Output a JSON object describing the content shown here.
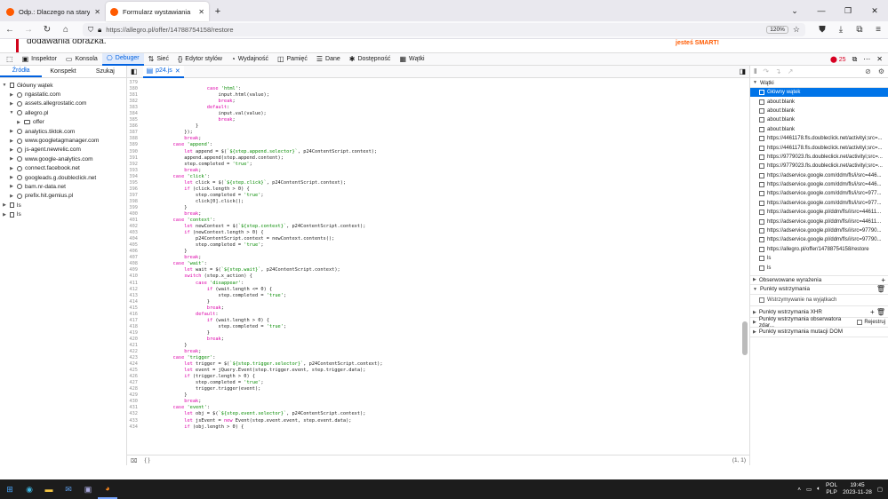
{
  "browser": {
    "tabs": [
      {
        "title": "Odp.: Dlaczego na starym form",
        "active": false
      },
      {
        "title": "Formularz wystawiania",
        "active": true
      }
    ],
    "new_tab_symbol": "+",
    "url": "https://allegro.pl/offer/14788754158/restore",
    "zoom": "120%"
  },
  "page_strip": {
    "text": "dodawania obrazka.",
    "brand_partial": "jesteś SMART!"
  },
  "devtools": {
    "tools": [
      {
        "label": "Inspektor",
        "icon": "inspector-icon"
      },
      {
        "label": "Konsola",
        "icon": "console-icon"
      },
      {
        "label": "Debuger",
        "icon": "debugger-icon",
        "selected": true
      },
      {
        "label": "Sieć",
        "icon": "network-icon"
      },
      {
        "label": "Edytor stylów",
        "icon": "style-editor-icon"
      },
      {
        "label": "Wydajność",
        "icon": "performance-icon"
      },
      {
        "label": "Pamięć",
        "icon": "memory-icon"
      },
      {
        "label": "Dane",
        "icon": "storage-icon"
      },
      {
        "label": "Dostępność",
        "icon": "accessibility-icon"
      },
      {
        "label": "Wątki",
        "icon": "application-icon"
      }
    ],
    "error_count": "25"
  },
  "sources": {
    "tabs": [
      "Źródła",
      "Konspekt",
      "Szukaj"
    ],
    "tree": [
      {
        "label": "Główny wątek",
        "level": 0,
        "type": "file",
        "open": true
      },
      {
        "label": "ngastatic.com",
        "level": 1,
        "type": "globe"
      },
      {
        "label": "assets.allegrostatic.com",
        "level": 1,
        "type": "globe"
      },
      {
        "label": "allegro.pl",
        "level": 1,
        "type": "globe",
        "open": true
      },
      {
        "label": "offer",
        "level": 2,
        "type": "folder"
      },
      {
        "label": "analytics.tiktok.com",
        "level": 1,
        "type": "globe"
      },
      {
        "label": "www.googletagmanager.com",
        "level": 1,
        "type": "globe"
      },
      {
        "label": "js-agent.newrelic.com",
        "level": 1,
        "type": "globe"
      },
      {
        "label": "www.google-analytics.com",
        "level": 1,
        "type": "globe"
      },
      {
        "label": "connect.facebook.net",
        "level": 1,
        "type": "globe"
      },
      {
        "label": "googleads.g.doubleclick.net",
        "level": 1,
        "type": "globe"
      },
      {
        "label": "bam.nr-data.net",
        "level": 1,
        "type": "globe"
      },
      {
        "label": "prefix.hit.gemius.pl",
        "level": 1,
        "type": "globe"
      },
      {
        "label": "ls",
        "level": 0,
        "type": "file"
      },
      {
        "label": "ls",
        "level": 0,
        "type": "file"
      }
    ]
  },
  "editor": {
    "file_tab": "p24.js",
    "footer_braces": "{ }",
    "cursor_position": "(1, 1)",
    "lines": [
      [
        "379",
        "                    "
      ],
      [
        "380",
        "                    case 'html':"
      ],
      [
        "381",
        "                        input.html(value);"
      ],
      [
        "382",
        "                        break;"
      ],
      [
        "383",
        "                    default:"
      ],
      [
        "384",
        "                        input.val(value);"
      ],
      [
        "385",
        "                        break;"
      ],
      [
        "386",
        "                }"
      ],
      [
        "387",
        "            });"
      ],
      [
        "388",
        "            break;"
      ],
      [
        "389",
        "        case 'append':"
      ],
      [
        "390",
        "            let append = $(`${step.append.selector}`, p24ContentScript.context);"
      ],
      [
        "391",
        "            append.append(step.append.content);"
      ],
      [
        "392",
        "            step.completed = 'true';"
      ],
      [
        "393",
        "            break;"
      ],
      [
        "394",
        "        case 'click':"
      ],
      [
        "395",
        "            let click = $(`${step.click}`, p24ContentScript.context);"
      ],
      [
        "396",
        "            if (click.length > 0) {"
      ],
      [
        "397",
        "                step.completed = 'true';"
      ],
      [
        "398",
        "                click[0].click();"
      ],
      [
        "399",
        "            }"
      ],
      [
        "400",
        "            break;"
      ],
      [
        "401",
        "        case 'context':"
      ],
      [
        "402",
        "            let newContext = $(`${step.context}`, p24ContentScript.context);"
      ],
      [
        "403",
        "            if (newContext.length > 0) {"
      ],
      [
        "404",
        "                p24ContentScript.context = newContext.contents();"
      ],
      [
        "405",
        "                step.completed = 'true';"
      ],
      [
        "406",
        "            }"
      ],
      [
        "407",
        "            break;"
      ],
      [
        "408",
        "        case 'wait':"
      ],
      [
        "409",
        "            let wait = $(`${step.wait}`, p24ContentScript.context);"
      ],
      [
        "410",
        "            switch (step.x_action) {"
      ],
      [
        "411",
        "                case 'disappear':"
      ],
      [
        "412",
        "                    if (wait.length <= 0) {"
      ],
      [
        "413",
        "                        step.completed = 'true';"
      ],
      [
        "414",
        "                    }"
      ],
      [
        "415",
        "                    break;"
      ],
      [
        "416",
        "                default:"
      ],
      [
        "417",
        "                    if (wait.length > 0) {"
      ],
      [
        "418",
        "                        step.completed = 'true';"
      ],
      [
        "419",
        "                    }"
      ],
      [
        "420",
        "                    break;"
      ],
      [
        "421",
        "            }"
      ],
      [
        "422",
        "            break;"
      ],
      [
        "423",
        "        case 'trigger':"
      ],
      [
        "424",
        "            let trigger = $(`${step.trigger.selector}`, p24ContentScript.context);"
      ],
      [
        "425",
        "            let event = jQuery.Event(step.trigger.event, step.trigger.data);"
      ],
      [
        "426",
        "            if (trigger.length > 0) {"
      ],
      [
        "427",
        "                step.completed = 'true';"
      ],
      [
        "428",
        "                trigger.trigger(event);"
      ],
      [
        "429",
        "            }"
      ],
      [
        "430",
        "            break;"
      ],
      [
        "431",
        "        case 'event':"
      ],
      [
        "432",
        "            let obj = $(`${step.event.selector}`, p24ContentScript.context);"
      ],
      [
        "433",
        "            let jsEvent = new Event(step.event.event, step.event.data);"
      ],
      [
        "434",
        "            if (obj.length > 0) {"
      ]
    ]
  },
  "debugger_panel": {
    "threads_title": "Wątki",
    "threads": [
      "Główny wątek",
      "about:blank",
      "about:blank",
      "about:blank",
      "about:blank",
      "https://4461178.fls.doubleclick.net/activityi;src=...",
      "https://4461178.fls.doubleclick.net/activityi;src=...",
      "https://9779023.fls.doubleclick.net/activityi;src=...",
      "https://9779023.fls.doubleclick.net/activityi;src=...",
      "https://adservice.google.com/ddm/fls/i/src=446...",
      "https://adservice.google.com/ddm/fls/i/src=446...",
      "https://adservice.google.com/ddm/fls/i/src=977...",
      "https://adservice.google.com/ddm/fls/i/src=977...",
      "https://adservice.google.pl/ddm/fls/i/src=44611...",
      "https://adservice.google.pl/ddm/fls/i/src=44611...",
      "https://adservice.google.pl/ddm/fls/i/src=97790...",
      "https://adservice.google.pl/ddm/fls/i/src=97790...",
      "https://allegro.pl/offer/14788754158/restore",
      "ls",
      "ls"
    ],
    "watch_label": "Obserwowane wyrażenia",
    "breakpoints_label": "Punkty wstrzymania",
    "pause_exceptions_label": "Wstrzymywanie na wyjątkach",
    "xhr_label": "Punkty wstrzymania XHR",
    "event_label": "Punkty wstrzymania obserwatora zdar...",
    "log_label": "Rejestruj",
    "dom_label": "Punkty wstrzymania mutacji DOM"
  },
  "taskbar": {
    "lang_top": "POL",
    "lang_bottom": "PLP",
    "time": "19:45",
    "date": "2023-11-28"
  }
}
